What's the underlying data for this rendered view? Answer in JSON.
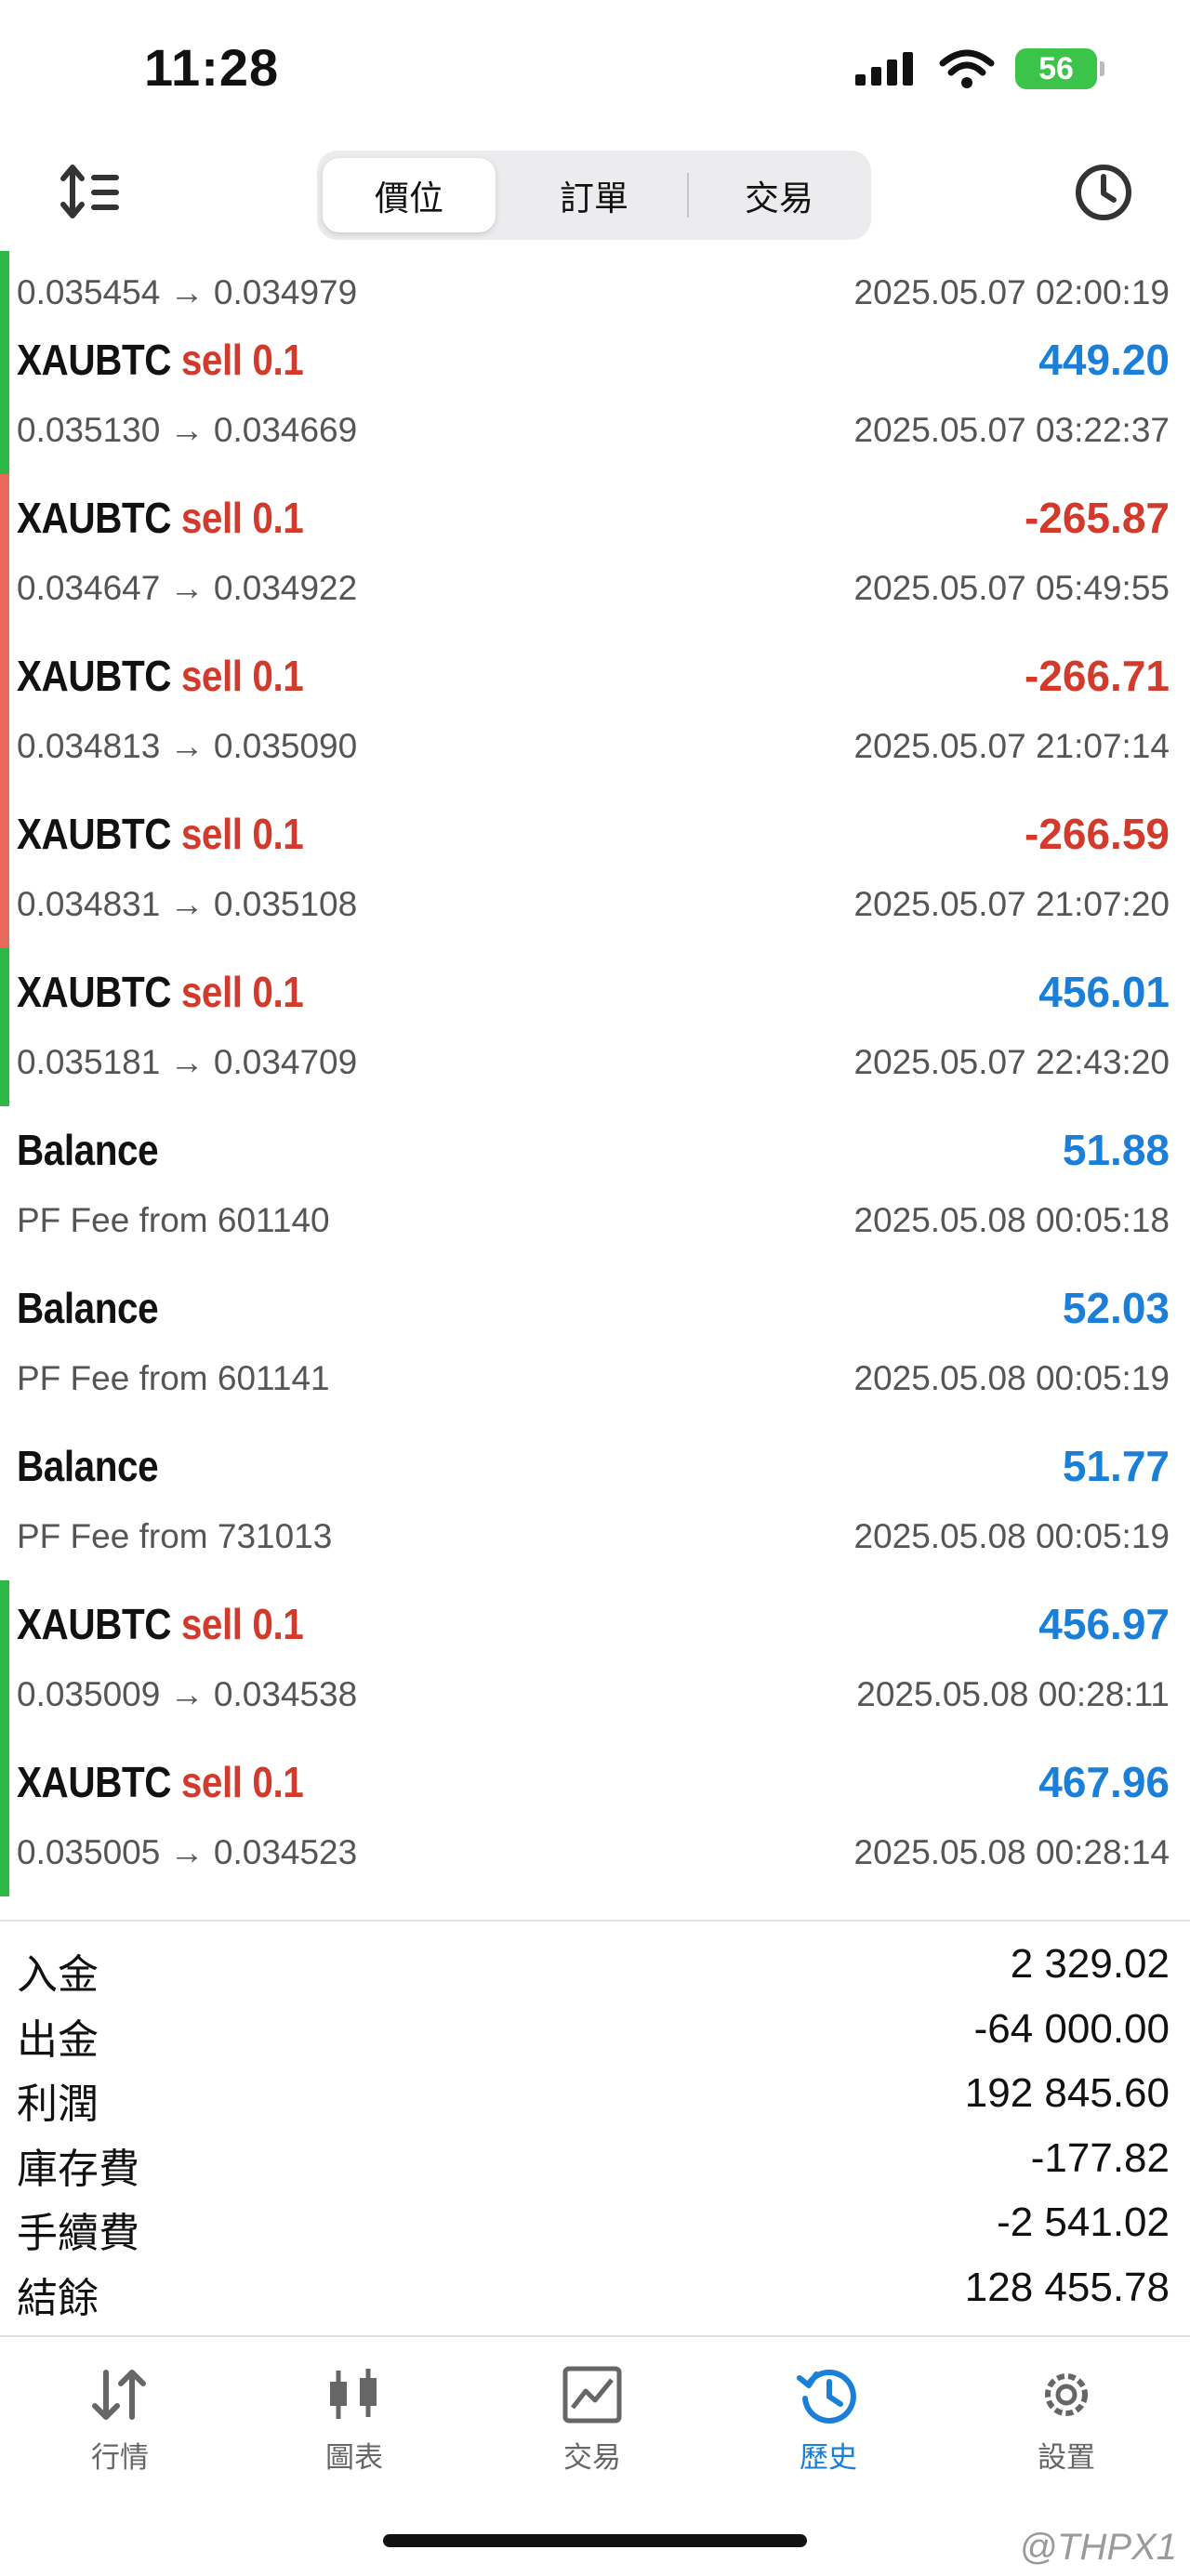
{
  "status_bar": {
    "time": "11:28",
    "battery": "56"
  },
  "toolbar": {
    "tabs": [
      {
        "label": "價位"
      },
      {
        "label": "訂單"
      },
      {
        "label": "交易"
      }
    ]
  },
  "history": {
    "first_partial": {
      "prices": "0.035454 → 0.034979",
      "time": "2025.05.07 02:00:19",
      "bar": "#2db843"
    },
    "rows": [
      {
        "symbol": "XAUBTC",
        "side": "sell 0.1",
        "profit": "449.20",
        "prices": "0.035130 → 0.034669",
        "time": "2025.05.07 03:22:37",
        "bar": "#2db843",
        "sign": "pos"
      },
      {
        "symbol": "XAUBTC",
        "side": "sell 0.1",
        "profit": "-265.87",
        "prices": "0.034647 → 0.034922",
        "time": "2025.05.07 05:49:55",
        "bar": "#e8685a",
        "sign": "neg"
      },
      {
        "symbol": "XAUBTC",
        "side": "sell 0.1",
        "profit": "-266.71",
        "prices": "0.034813 → 0.035090",
        "time": "2025.05.07 21:07:14",
        "bar": "#e8685a",
        "sign": "neg"
      },
      {
        "symbol": "XAUBTC",
        "side": "sell 0.1",
        "profit": "-266.59",
        "prices": "0.034831 → 0.035108",
        "time": "2025.05.07 21:07:20",
        "bar": "#e8685a",
        "sign": "neg"
      },
      {
        "symbol": "XAUBTC",
        "side": "sell 0.1",
        "profit": "456.01",
        "prices": "0.035181 → 0.034709",
        "time": "2025.05.07 22:43:20",
        "bar": "#2db843",
        "sign": "pos"
      },
      {
        "symbol": "Balance",
        "side": "",
        "profit": "51.88",
        "prices": "PF Fee from 601140",
        "time": "2025.05.08 00:05:18",
        "bar": "",
        "sign": "pos"
      },
      {
        "symbol": "Balance",
        "side": "",
        "profit": "52.03",
        "prices": "PF Fee from 601141",
        "time": "2025.05.08 00:05:19",
        "bar": "",
        "sign": "pos"
      },
      {
        "symbol": "Balance",
        "side": "",
        "profit": "51.77",
        "prices": "PF Fee from 731013",
        "time": "2025.05.08 00:05:19",
        "bar": "",
        "sign": "pos"
      },
      {
        "symbol": "XAUBTC",
        "side": "sell 0.1",
        "profit": "456.97",
        "prices": "0.035009 → 0.034538",
        "time": "2025.05.08 00:28:11",
        "bar": "#2db843",
        "sign": "pos"
      },
      {
        "symbol": "XAUBTC",
        "side": "sell 0.1",
        "profit": "467.96",
        "prices": "0.035005 → 0.034523",
        "time": "2025.05.08 00:28:14",
        "bar": "#2db843",
        "sign": "pos"
      }
    ]
  },
  "summary": [
    {
      "label": "入金",
      "value": "2 329.02"
    },
    {
      "label": "出金",
      "value": "-64 000.00"
    },
    {
      "label": "利潤",
      "value": "192 845.60"
    },
    {
      "label": "庫存費",
      "value": "-177.82"
    },
    {
      "label": "手續費",
      "value": "-2 541.02"
    },
    {
      "label": "結餘",
      "value": "128 455.78"
    }
  ],
  "tabbar": {
    "tabs": [
      {
        "label": "行情",
        "icon": "quotes-icon"
      },
      {
        "label": "圖表",
        "icon": "chart-icon"
      },
      {
        "label": "交易",
        "icon": "trade-icon"
      },
      {
        "label": "歷史",
        "icon": "history-icon",
        "active": true
      },
      {
        "label": "設置",
        "icon": "settings-icon"
      }
    ]
  },
  "colors": {
    "positive": "#1a7fd8",
    "negative": "#d23a2c",
    "active_tab": "#1a7fd8"
  },
  "watermark": "@THPX1"
}
